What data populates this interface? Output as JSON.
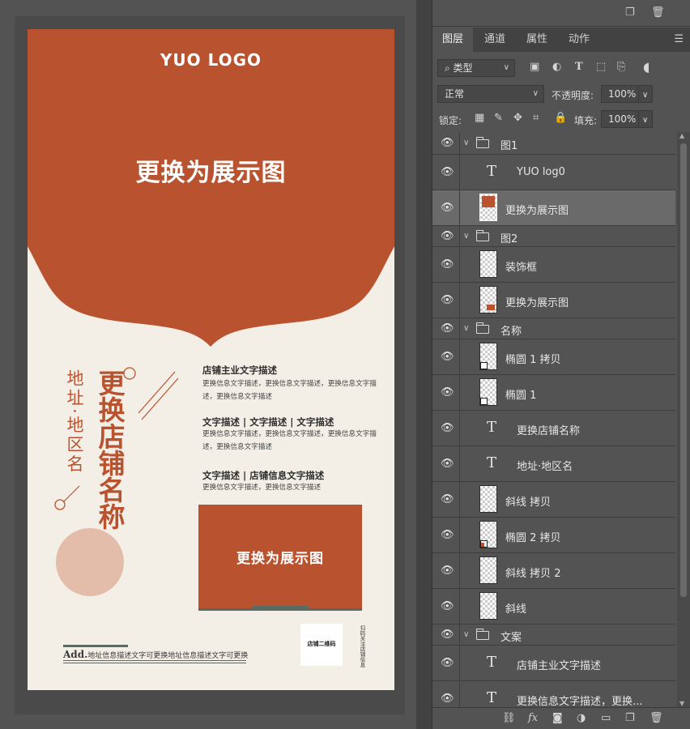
{
  "poster": {
    "logo": "YUO LOGO",
    "hero_placeholder": "更换为展示图",
    "shop_name": "更换店铺名称",
    "address": "地址·地区名",
    "blocks": [
      {
        "title": "店铺主业文字描述",
        "body": "更换信息文字描述，更换信息文字描述，更换信息文字描述，更换信息文字描述"
      },
      {
        "title": "文字描述 | 文字描述 | 文字描述",
        "body": "更换信息文字描述，更换信息文字描述，更换信息文字描述，更换信息文字描述"
      },
      {
        "title": "文字描述 | 店铺信息文字描述",
        "body": "更换信息文字描述，更换信息文字描述"
      }
    ],
    "image_box_label": "更换为展示图",
    "qr_label": "店铺二维码",
    "qr_side_text": "扫码关注店铺信息",
    "address_prefix": "Add.",
    "address_line": "地址信息描述文字可更换地址信息描述文字可更换",
    "colors": {
      "accent": "#b9532f",
      "cream": "#f3efe6",
      "circle": "#e4bdaa",
      "dark_line": "#5b6b63"
    }
  },
  "panel": {
    "tabs": [
      "图层",
      "通道",
      "属性",
      "动作"
    ],
    "active_tab": "图层",
    "filter_type": "类型",
    "blend_mode": "正常",
    "opacity_label": "不透明度:",
    "opacity_value": "100%",
    "lock_label": "锁定:",
    "fill_label": "填充:",
    "fill_value": "100%",
    "layers": [
      {
        "name": "图1",
        "kind": "group"
      },
      {
        "name": "YUO log0",
        "kind": "text"
      },
      {
        "name": "更换为展示图",
        "kind": "image",
        "selected": true
      },
      {
        "name": "图2",
        "kind": "group"
      },
      {
        "name": "装饰框",
        "kind": "image"
      },
      {
        "name": "更换为展示图",
        "kind": "image"
      },
      {
        "name": "名称",
        "kind": "group"
      },
      {
        "name": "椭圆 1 拷贝",
        "kind": "shape"
      },
      {
        "name": "椭圆 1",
        "kind": "shape"
      },
      {
        "name": "更换店铺名称",
        "kind": "text"
      },
      {
        "name": "地址·地区名",
        "kind": "text"
      },
      {
        "name": "斜线 拷贝",
        "kind": "image"
      },
      {
        "name": "椭圆 2 拷贝",
        "kind": "shape"
      },
      {
        "name": "斜线 拷贝 2",
        "kind": "image"
      },
      {
        "name": "斜线",
        "kind": "image"
      },
      {
        "name": "文案",
        "kind": "group"
      },
      {
        "name": "店铺主业文字描述",
        "kind": "text"
      },
      {
        "name": "更换信息文字描述，更换...",
        "kind": "text"
      }
    ],
    "icons": {
      "top": [
        "new-layer-icon",
        "trash-icon"
      ],
      "filter": [
        "image-filter-icon",
        "adjust-filter-icon",
        "text-filter-icon",
        "shape-filter-icon",
        "smart-filter-icon",
        "filter-toggle-icon"
      ],
      "lock": [
        "lock-pixels-icon",
        "lock-brush-icon",
        "lock-move-icon",
        "lock-artboard-icon",
        "lock-all-icon"
      ],
      "bottom": [
        "link-icon",
        "fx-icon",
        "mask-icon",
        "adjustment-icon",
        "group-icon",
        "new-layer-icon",
        "trash-icon"
      ]
    }
  }
}
